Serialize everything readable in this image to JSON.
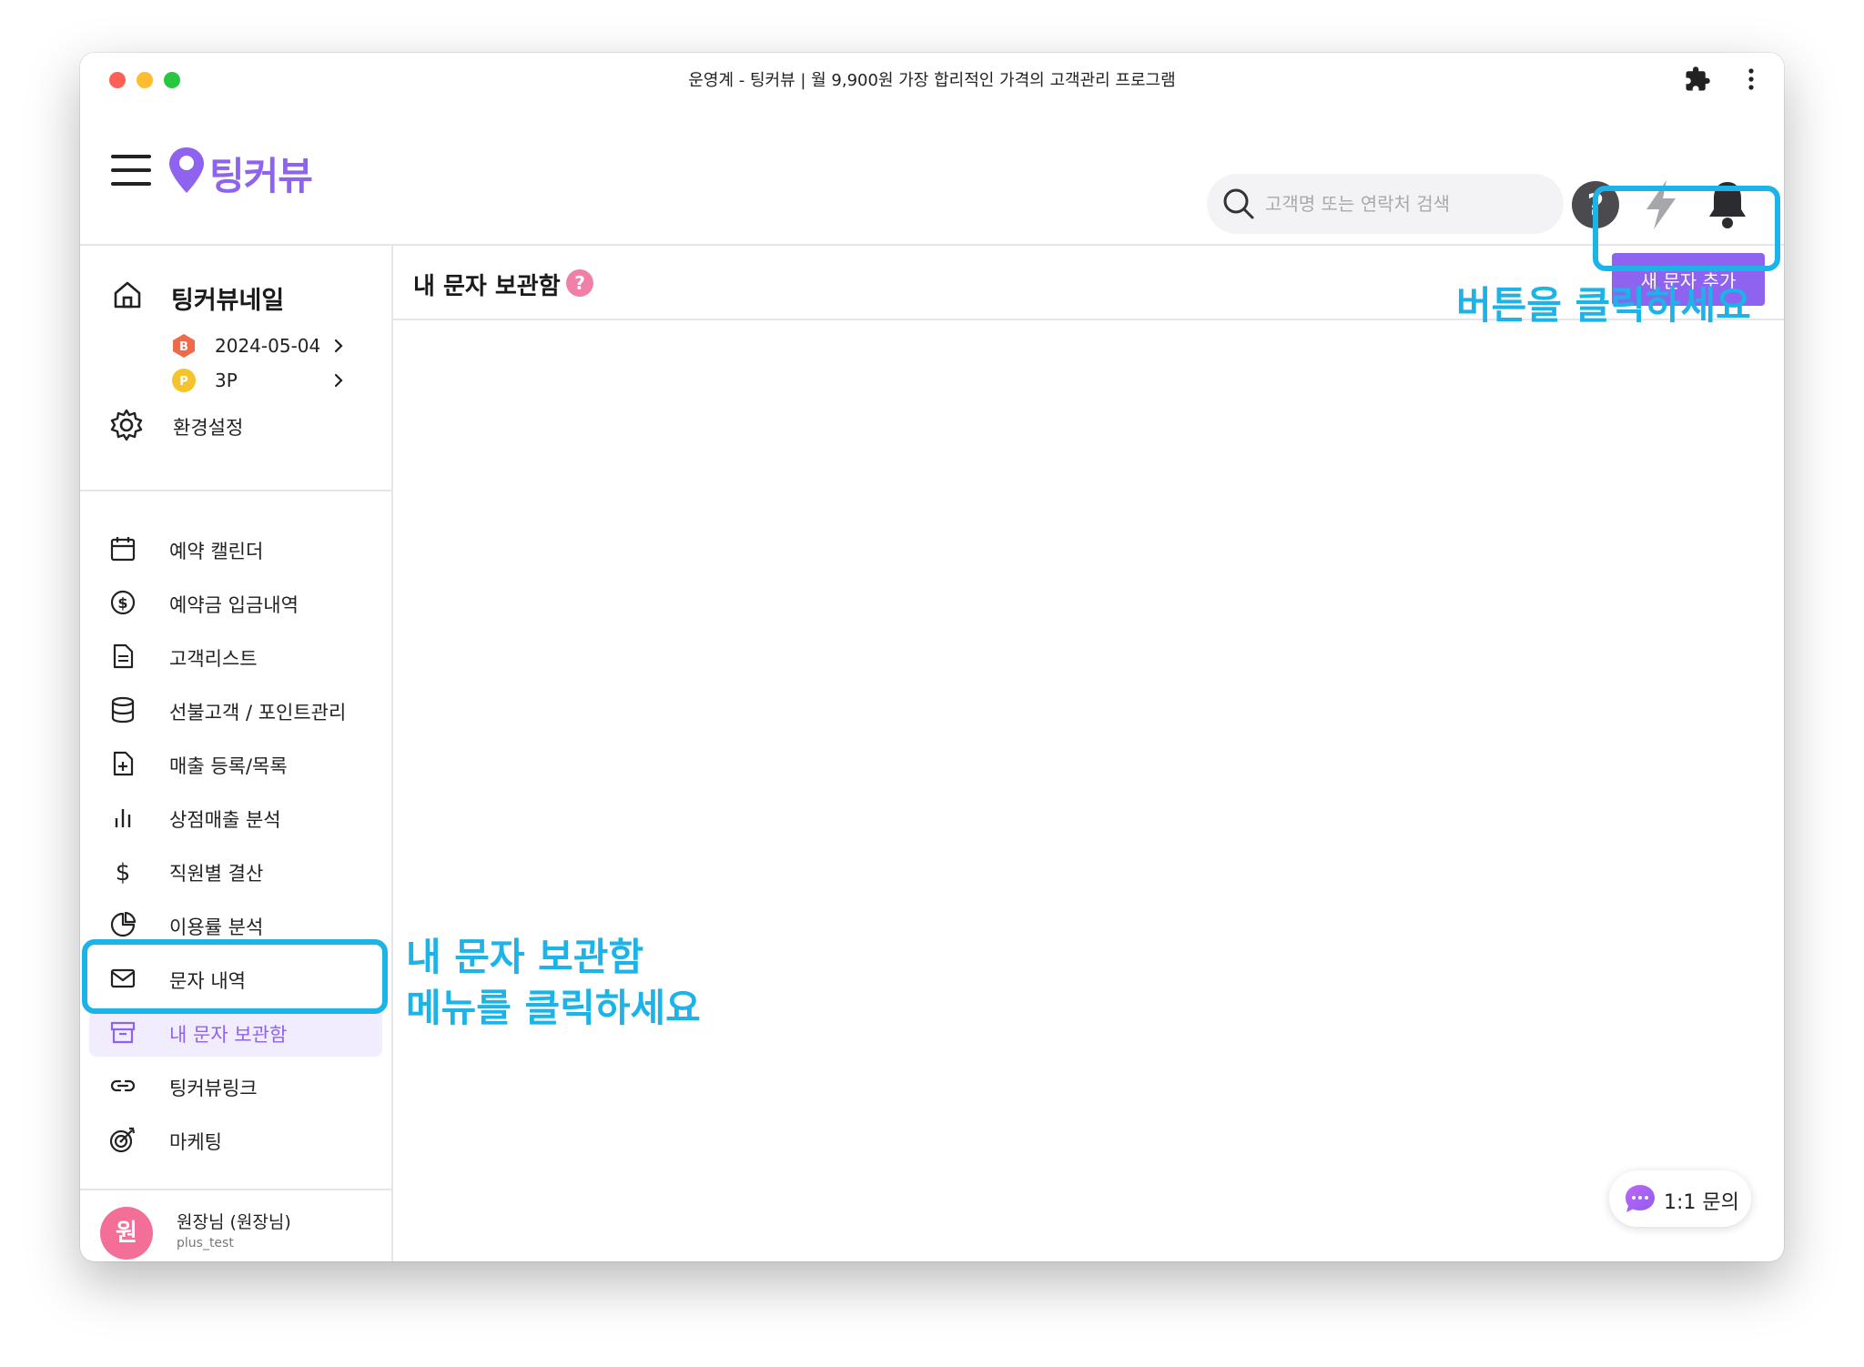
{
  "window": {
    "title": "운영계 - 팅커뷰 | 월 9,900원 가장 합리적인 가격의 고객관리 프로그램"
  },
  "header": {
    "logo_text": "팅커뷰",
    "search_placeholder": "고객명 또는 연락처 검색"
  },
  "sidebar": {
    "store_name": "팅커뷰네일",
    "expiry_badge": "B",
    "expiry_date": "2024-05-04",
    "points_badge": "P",
    "points": "3P",
    "settings_label": "환경설정",
    "items": [
      {
        "label": "예약 캘린더",
        "icon": "calendar-icon"
      },
      {
        "label": "예약금 입금내역",
        "icon": "dollar-circle-icon"
      },
      {
        "label": "고객리스트",
        "icon": "document-icon"
      },
      {
        "label": "선불고객 / 포인트관리",
        "icon": "database-icon"
      },
      {
        "label": "매출 등록/목록",
        "icon": "file-plus-icon"
      },
      {
        "label": "상점매출 분석",
        "icon": "bar-chart-icon"
      },
      {
        "label": "직원별 결산",
        "icon": "dollar-icon"
      },
      {
        "label": "이용률 분석",
        "icon": "pie-chart-icon"
      },
      {
        "label": "문자 내역",
        "icon": "mail-icon"
      },
      {
        "label": "내 문자 보관함",
        "icon": "archive-icon",
        "active": true
      },
      {
        "label": "팅커뷰링크",
        "icon": "link-icon"
      },
      {
        "label": "마케팅",
        "icon": "target-icon"
      }
    ],
    "profile": {
      "avatar": "원",
      "name": "원장님 (원장님)",
      "id": "plus_test"
    }
  },
  "main": {
    "title": "내 문자 보관함",
    "help": "?",
    "new_message_button": "새 문자 추가"
  },
  "chat_button": "1:1 문의",
  "annotations": {
    "button_hint": "버튼을 클릭하세요",
    "menu_hint_line1": "내 문자 보관함",
    "menu_hint_line2": "메뉴를 클릭하세요"
  },
  "colors": {
    "brand": "#8e63f0",
    "annotation": "#1cb4e8",
    "active_bg": "#f1ecfe"
  }
}
